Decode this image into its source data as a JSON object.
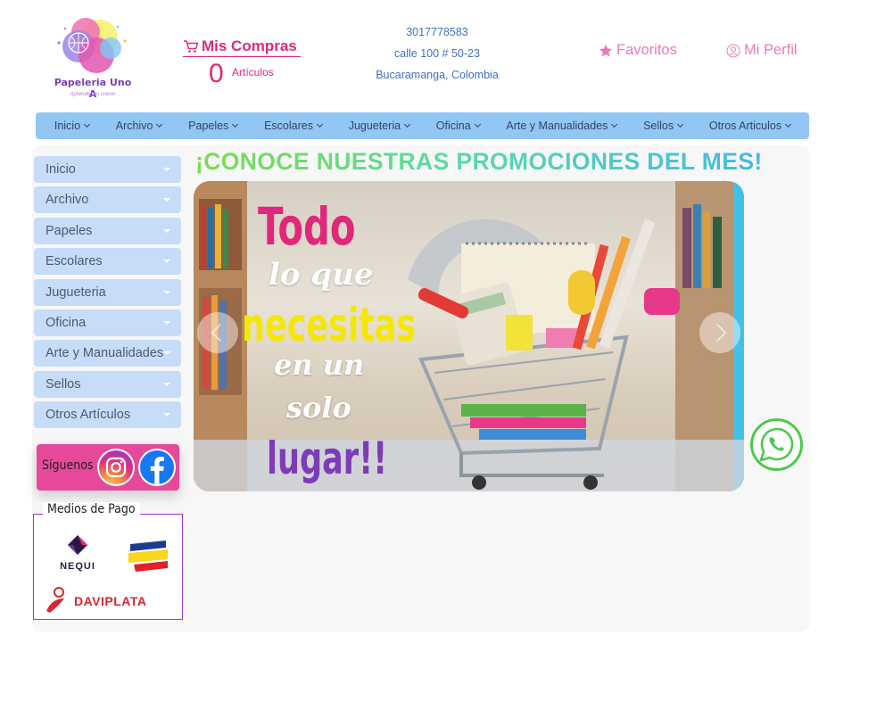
{
  "brand": {
    "name": "Papeleria Uno A",
    "tagline": "Aprender es crecer"
  },
  "cart": {
    "title": "Mis Compras",
    "count": "0",
    "count_label": "Artículos",
    "icon": "shopping-cart-icon"
  },
  "contact": {
    "phone": "3017778583",
    "address": "calle 100 # 50-23",
    "city": "Bucaramanga, Colombia"
  },
  "account": {
    "favorites": "Favoritos",
    "favorites_icon": "star-icon",
    "profile": "Mi Perfil",
    "profile_icon": "user-icon"
  },
  "topnav": [
    {
      "label": "Inicio"
    },
    {
      "label": "Archivo"
    },
    {
      "label": "Papeles"
    },
    {
      "label": "Escolares"
    },
    {
      "label": "Jugueteria"
    },
    {
      "label": "Oficina"
    },
    {
      "label": "Arte y Manualidades"
    },
    {
      "label": "Sellos"
    },
    {
      "label": "Otros Articulos"
    }
  ],
  "sidebar": {
    "items": [
      {
        "label": "Inicio"
      },
      {
        "label": "Archivo"
      },
      {
        "label": "Papeles"
      },
      {
        "label": "Escolares"
      },
      {
        "label": "Jugueteria"
      },
      {
        "label": "Oficina"
      },
      {
        "label": "Arte y Manualidades"
      },
      {
        "label": "Sellos"
      },
      {
        "label": "Otros Artículos"
      }
    ],
    "social_label": "Síguenos",
    "payments_title": "Medios de Pago",
    "payments": {
      "nequi": "NEQUI",
      "daviplata": "DAVIPLATA"
    }
  },
  "promo": {
    "title": "¡CONOCE NUESTRAS PROMOCIONES DEL MES!",
    "slide": {
      "line1": "Todo",
      "line2": "lo que",
      "line3": "necesitas",
      "line4": "en un",
      "line5": "solo",
      "line6": "lugar!!"
    }
  },
  "colors": {
    "accent_pink": "#e0287a",
    "nav_blue": "#92c7f3",
    "side_blue": "#c7dcf8",
    "link_blue": "#3f72c0",
    "whatsapp_green": "#4cc94c"
  }
}
